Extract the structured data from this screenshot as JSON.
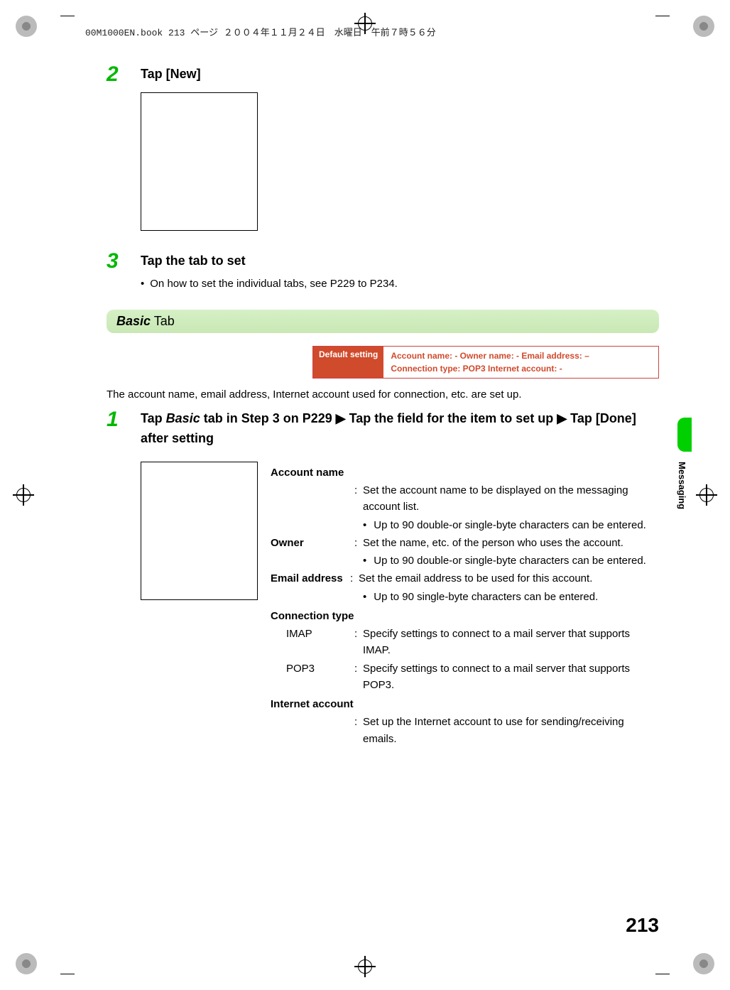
{
  "header": "00M1000EN.book  213 ページ  ２００４年１１月２４日　水曜日　午前７時５６分",
  "step2": {
    "num": "2",
    "title": "Tap [New]"
  },
  "step3": {
    "num": "3",
    "title": "Tap the tab to set",
    "bullet": "On how to set the individual tabs, see P229 to P234."
  },
  "section": {
    "italic": "Basic",
    "rest": " Tab"
  },
  "default_setting": {
    "label": "Default setting",
    "value": "Account name: -    Owner name: -    Email address: –\nConnection type: POP3    Internet account: -"
  },
  "intro": "The account name, email address, Internet account used for connection, etc. are set up.",
  "step1": {
    "num": "1",
    "line1_a": "Tap ",
    "line1_b": "Basic",
    "line1_c": " tab in Step 3 on P229 ",
    "arrow": "▶",
    "line1_d": " Tap the field for the item to set up ",
    "line1_e": " Tap [Done] after setting"
  },
  "defs": {
    "account_name": {
      "term": "Account name",
      "desc": "Set the account name to be displayed on the messaging account list.",
      "sub": "Up to 90 double-or single-byte characters can be entered."
    },
    "owner": {
      "term": "Owner",
      "desc": "Set the name, etc. of the person who uses the account.",
      "sub": "Up to 90 double-or single-byte characters can be entered."
    },
    "email": {
      "term": "Email address",
      "desc": "Set the email address to be used for this account.",
      "sub": "Up to 90 single-byte characters can be entered."
    },
    "conn_header": "Connection type",
    "imap": {
      "term": "IMAP",
      "desc": "Specify settings to connect to a mail server that supports IMAP."
    },
    "pop3": {
      "term": "POP3",
      "desc": "Specify settings to connect to a mail server that supports POP3."
    },
    "internet": {
      "header": "Internet account",
      "desc": "Set up the Internet account to use for sending/receiving emails."
    }
  },
  "side_label": "Messaging",
  "page_number": "213"
}
